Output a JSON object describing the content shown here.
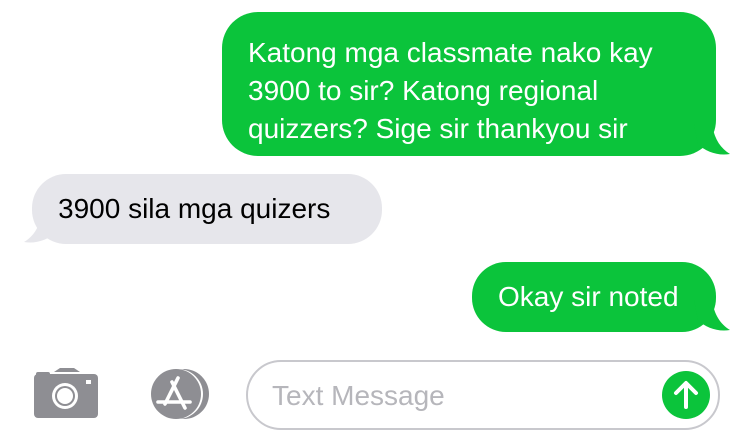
{
  "conversation": {
    "messages": [
      {
        "direction": "sent",
        "text": "Katong mga classmate nako kay\n3900 to sir? Katong regional\nquizzers? Sige sir thankyou sir"
      },
      {
        "direction": "received",
        "text": "3900 sila mga quizers"
      },
      {
        "direction": "sent",
        "text": "Okay sir noted"
      }
    ]
  },
  "composer": {
    "placeholder": "Text Message",
    "value": ""
  },
  "icons": {
    "camera": "camera-icon",
    "app_store": "app-store-icon",
    "send": "send-arrow-icon"
  },
  "colors": {
    "sent_bubble": "#0bc43b",
    "received_bubble": "#e6e6eb",
    "icon_gray": "#8e8e93"
  }
}
